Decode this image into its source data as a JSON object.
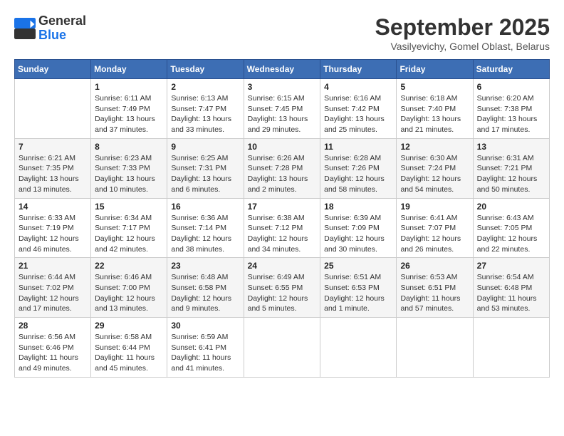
{
  "logo": {
    "general": "General",
    "blue": "Blue"
  },
  "title": "September 2025",
  "location": "Vasilyevichy, Gomel Oblast, Belarus",
  "days_of_week": [
    "Sunday",
    "Monday",
    "Tuesday",
    "Wednesday",
    "Thursday",
    "Friday",
    "Saturday"
  ],
  "weeks": [
    [
      {
        "day": "",
        "info": ""
      },
      {
        "day": "1",
        "info": "Sunrise: 6:11 AM\nSunset: 7:49 PM\nDaylight: 13 hours\nand 37 minutes."
      },
      {
        "day": "2",
        "info": "Sunrise: 6:13 AM\nSunset: 7:47 PM\nDaylight: 13 hours\nand 33 minutes."
      },
      {
        "day": "3",
        "info": "Sunrise: 6:15 AM\nSunset: 7:45 PM\nDaylight: 13 hours\nand 29 minutes."
      },
      {
        "day": "4",
        "info": "Sunrise: 6:16 AM\nSunset: 7:42 PM\nDaylight: 13 hours\nand 25 minutes."
      },
      {
        "day": "5",
        "info": "Sunrise: 6:18 AM\nSunset: 7:40 PM\nDaylight: 13 hours\nand 21 minutes."
      },
      {
        "day": "6",
        "info": "Sunrise: 6:20 AM\nSunset: 7:38 PM\nDaylight: 13 hours\nand 17 minutes."
      }
    ],
    [
      {
        "day": "7",
        "info": "Sunrise: 6:21 AM\nSunset: 7:35 PM\nDaylight: 13 hours\nand 13 minutes."
      },
      {
        "day": "8",
        "info": "Sunrise: 6:23 AM\nSunset: 7:33 PM\nDaylight: 13 hours\nand 10 minutes."
      },
      {
        "day": "9",
        "info": "Sunrise: 6:25 AM\nSunset: 7:31 PM\nDaylight: 13 hours\nand 6 minutes."
      },
      {
        "day": "10",
        "info": "Sunrise: 6:26 AM\nSunset: 7:28 PM\nDaylight: 13 hours\nand 2 minutes."
      },
      {
        "day": "11",
        "info": "Sunrise: 6:28 AM\nSunset: 7:26 PM\nDaylight: 12 hours\nand 58 minutes."
      },
      {
        "day": "12",
        "info": "Sunrise: 6:30 AM\nSunset: 7:24 PM\nDaylight: 12 hours\nand 54 minutes."
      },
      {
        "day": "13",
        "info": "Sunrise: 6:31 AM\nSunset: 7:21 PM\nDaylight: 12 hours\nand 50 minutes."
      }
    ],
    [
      {
        "day": "14",
        "info": "Sunrise: 6:33 AM\nSunset: 7:19 PM\nDaylight: 12 hours\nand 46 minutes."
      },
      {
        "day": "15",
        "info": "Sunrise: 6:34 AM\nSunset: 7:17 PM\nDaylight: 12 hours\nand 42 minutes."
      },
      {
        "day": "16",
        "info": "Sunrise: 6:36 AM\nSunset: 7:14 PM\nDaylight: 12 hours\nand 38 minutes."
      },
      {
        "day": "17",
        "info": "Sunrise: 6:38 AM\nSunset: 7:12 PM\nDaylight: 12 hours\nand 34 minutes."
      },
      {
        "day": "18",
        "info": "Sunrise: 6:39 AM\nSunset: 7:09 PM\nDaylight: 12 hours\nand 30 minutes."
      },
      {
        "day": "19",
        "info": "Sunrise: 6:41 AM\nSunset: 7:07 PM\nDaylight: 12 hours\nand 26 minutes."
      },
      {
        "day": "20",
        "info": "Sunrise: 6:43 AM\nSunset: 7:05 PM\nDaylight: 12 hours\nand 22 minutes."
      }
    ],
    [
      {
        "day": "21",
        "info": "Sunrise: 6:44 AM\nSunset: 7:02 PM\nDaylight: 12 hours\nand 17 minutes."
      },
      {
        "day": "22",
        "info": "Sunrise: 6:46 AM\nSunset: 7:00 PM\nDaylight: 12 hours\nand 13 minutes."
      },
      {
        "day": "23",
        "info": "Sunrise: 6:48 AM\nSunset: 6:58 PM\nDaylight: 12 hours\nand 9 minutes."
      },
      {
        "day": "24",
        "info": "Sunrise: 6:49 AM\nSunset: 6:55 PM\nDaylight: 12 hours\nand 5 minutes."
      },
      {
        "day": "25",
        "info": "Sunrise: 6:51 AM\nSunset: 6:53 PM\nDaylight: 12 hours\nand 1 minute."
      },
      {
        "day": "26",
        "info": "Sunrise: 6:53 AM\nSunset: 6:51 PM\nDaylight: 11 hours\nand 57 minutes."
      },
      {
        "day": "27",
        "info": "Sunrise: 6:54 AM\nSunset: 6:48 PM\nDaylight: 11 hours\nand 53 minutes."
      }
    ],
    [
      {
        "day": "28",
        "info": "Sunrise: 6:56 AM\nSunset: 6:46 PM\nDaylight: 11 hours\nand 49 minutes."
      },
      {
        "day": "29",
        "info": "Sunrise: 6:58 AM\nSunset: 6:44 PM\nDaylight: 11 hours\nand 45 minutes."
      },
      {
        "day": "30",
        "info": "Sunrise: 6:59 AM\nSunset: 6:41 PM\nDaylight: 11 hours\nand 41 minutes."
      },
      {
        "day": "",
        "info": ""
      },
      {
        "day": "",
        "info": ""
      },
      {
        "day": "",
        "info": ""
      },
      {
        "day": "",
        "info": ""
      }
    ]
  ]
}
